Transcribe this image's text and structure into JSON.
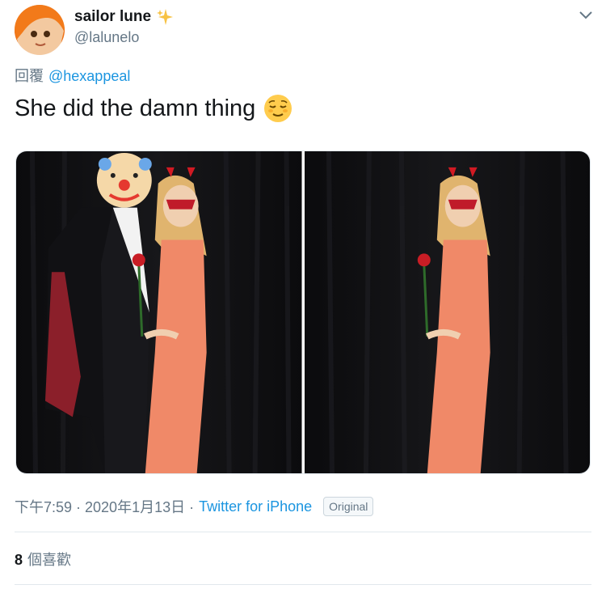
{
  "user": {
    "display_name": "sailor lune",
    "handle": "@lalunelo"
  },
  "reply": {
    "prefix": "回覆",
    "mention": "@hexappeal"
  },
  "tweet": {
    "text": "She did the damn thing"
  },
  "meta": {
    "timestamp": "下午7:59 · 2020年1月13日 ·",
    "source": "Twitter for iPhone",
    "badge": "Original"
  },
  "stats": {
    "likes_count": "8",
    "likes_label": "個喜歡"
  },
  "icons": {
    "sparkle": "sparkle-icon",
    "caret": "chevron-down-icon",
    "emoji": "relieved-face-emoji"
  },
  "colors": {
    "link": "#1b95e0",
    "muted": "#657786",
    "text": "#14171a"
  }
}
